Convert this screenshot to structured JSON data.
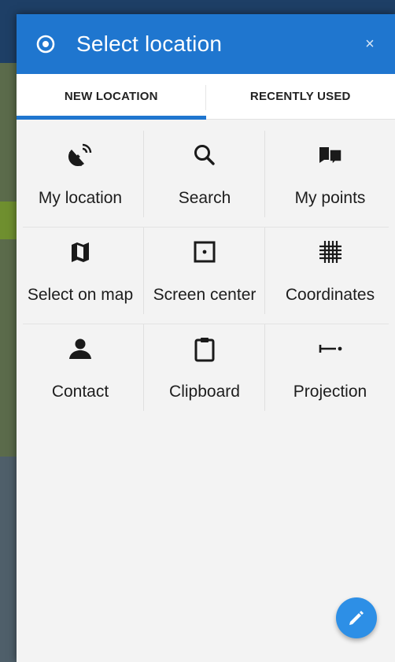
{
  "dialog": {
    "title": "Select location",
    "close_label": "×",
    "header_color": "#1f76cf"
  },
  "tabs": [
    {
      "label": "NEW LOCATION",
      "active": true
    },
    {
      "label": "RECENTLY USED",
      "active": false
    }
  ],
  "options": [
    {
      "label": "My location",
      "icon": "satellite-dish-icon"
    },
    {
      "label": "Search",
      "icon": "magnifier-icon"
    },
    {
      "label": "My points",
      "icon": "folders-icon"
    },
    {
      "label": "Select on map",
      "icon": "map-icon"
    },
    {
      "label": "Screen center",
      "icon": "center-square-icon"
    },
    {
      "label": "Coordinates",
      "icon": "grid-icon"
    },
    {
      "label": "Contact",
      "icon": "person-icon"
    },
    {
      "label": "Clipboard",
      "icon": "clipboard-icon"
    },
    {
      "label": "Projection",
      "icon": "projection-icon"
    }
  ],
  "fab": {
    "icon": "pencil-icon",
    "color": "#2d8fe6"
  }
}
